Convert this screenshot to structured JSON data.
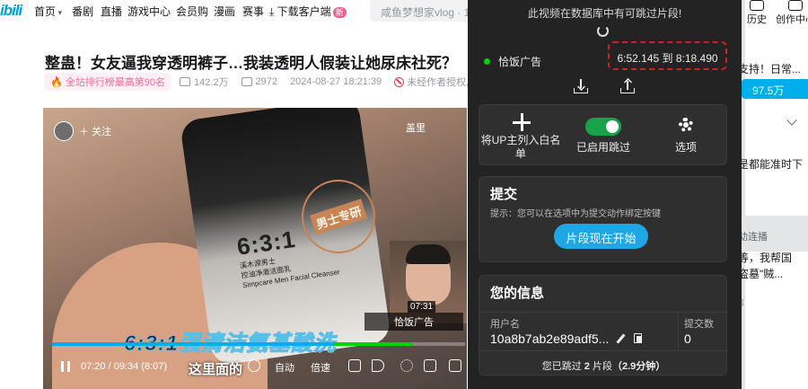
{
  "topnav": {
    "logo_text": "ibili",
    "items": [
      "首页",
      "番剧",
      "直播",
      "游戏中心",
      "会员购",
      "漫画",
      "赛事"
    ],
    "download_label": "下载客户端",
    "download_badge": "新",
    "search_placeholder": "咸鱼梦想家vlog · 1c",
    "right_items": [
      "历史",
      "创作中心"
    ]
  },
  "video": {
    "title": "整蛊！女友逼我穿透明裤子…我装透明人假装让她尿床社死？",
    "rank_badge": "全站排行榜最高第90名",
    "views": "142.2万",
    "danmaku": "2972",
    "date": "2024-08-27 18:21:39",
    "no_repost": "未经作者授权,",
    "follow_label": "关注",
    "player_top_right": "盖里",
    "bottle_brand_big": "6:3:1",
    "bottle_brand_line1": "溪木源男士",
    "bottle_brand_line2": "控油净澈洁面乳",
    "bottle_brand_line3": "Simpcare Men Facial Cleanser",
    "stamp_text": "男士专研",
    "hover_time": "07:31",
    "segment_tooltip": "恰饭广告",
    "subtitle_big": "6:3:1强清洁氨基酸洗",
    "subtitle_small": "这里面的",
    "time_display": "07:20 / 09:34 (8:07)",
    "auto_label": "自动",
    "speed_label": "倍速",
    "progress": 0.7666,
    "sponsor_start": 0.6812,
    "sponsor_end": 0.8745
  },
  "sidebar": {
    "support_text": "支持！日常...",
    "charge_amount": "97.5万",
    "line1": "是都能准时下",
    "autoplay_label": "动连播",
    "line2": "等，我帮国",
    "line3": "盗墓\"贼...",
    "num": "8",
    "excl": "!"
  },
  "popup": {
    "notice": "此视频在数据库中有可跳过片段!",
    "segment_category": "恰饭广告",
    "segment_time": "6:52.145 到 8:18.490",
    "options": {
      "whitelist_label": "将UP主列入白名单",
      "skip_enabled_label": "已启用跳过",
      "settings_label": "选项"
    },
    "submit": {
      "title": "提交",
      "hint": "提示：您可以在选项中为提交动作绑定按键",
      "button": "片段现在开始"
    },
    "info": {
      "title": "您的信息",
      "username_label": "用户名",
      "username": "10a8b7ab2e89adf5...",
      "submissions_label": "提交数",
      "submissions": "0",
      "skipped_prefix": "您已跳过",
      "skipped_count": "2",
      "skipped_mid": "片段",
      "skipped_time": "（2.9分钟）"
    }
  },
  "colors": {
    "accent": "#00aeec",
    "sponsor": "#00d400",
    "toggle_on": "#16a34a",
    "pink": "#ff6699"
  }
}
